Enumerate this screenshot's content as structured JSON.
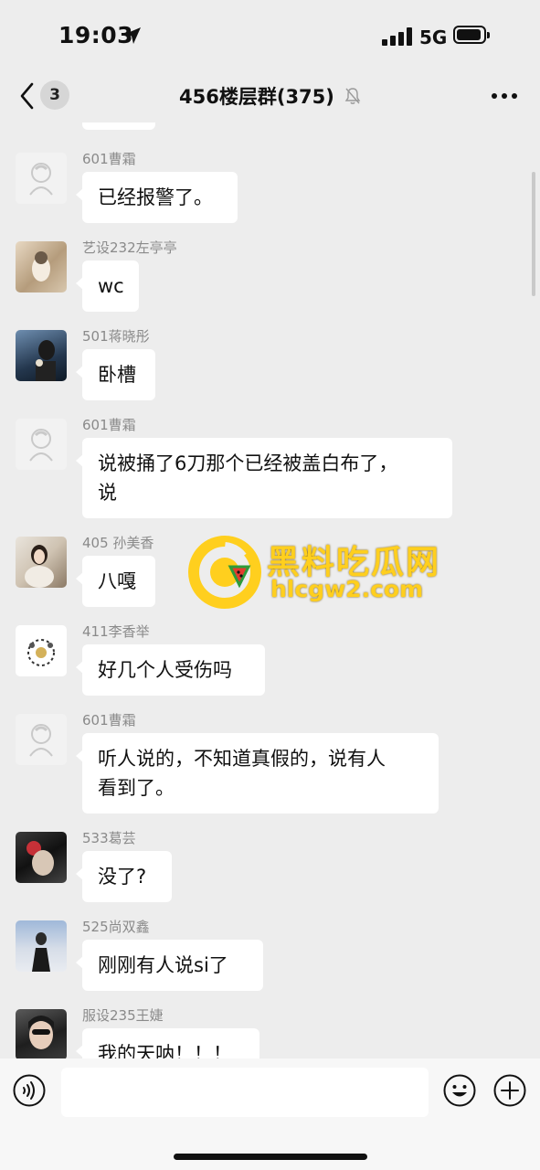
{
  "status": {
    "time": "19:03",
    "network": "5G"
  },
  "nav": {
    "unread_count": "3",
    "title": "456楼层群(375)"
  },
  "messages": [
    {
      "name": "601曹霜",
      "text": "已经报警了。",
      "avatar_icon": "default-avatar-icon"
    },
    {
      "name": "艺设232左亭亭",
      "text": "wc",
      "avatar_icon": "dog-photo-avatar"
    },
    {
      "name": "501蒋晓彤",
      "text": "卧槽",
      "avatar_icon": "portrait-photo-avatar"
    },
    {
      "name": "601曹霜",
      "text_line1": "说被捅了6刀那个已经被盖白布了，",
      "text_line2": "说",
      "avatar_icon": "default-avatar-icon"
    },
    {
      "name": "405 孙美香",
      "text": "八嘎",
      "avatar_icon": "portrait-photo-avatar"
    },
    {
      "name": "411李香举",
      "text": "好几个人受伤吗",
      "avatar_icon": "cartoon-avatar"
    },
    {
      "name": "601曹霜",
      "text_line1": "听人说的，不知道真假的，说有人",
      "text_line2": "看到了。",
      "avatar_icon": "default-avatar-icon"
    },
    {
      "name": "533葛芸",
      "text": "没了?",
      "avatar_icon": "portrait-photo-avatar"
    },
    {
      "name": "525尚双鑫",
      "text": "刚刚有人说si了",
      "avatar_icon": "portrait-photo-avatar"
    },
    {
      "name": "服设235王婕",
      "text": "我的天呐！！！",
      "avatar_icon": "portrait-photo-avatar"
    }
  ],
  "watermark": {
    "title": "黑料吃瓜网",
    "url": "hlcgw2.com"
  },
  "input": {
    "placeholder": ""
  },
  "colors": {
    "background": "#ededed",
    "bubble": "#ffffff",
    "name": "#8a8a8a",
    "watermark": "#ffcf1e"
  }
}
